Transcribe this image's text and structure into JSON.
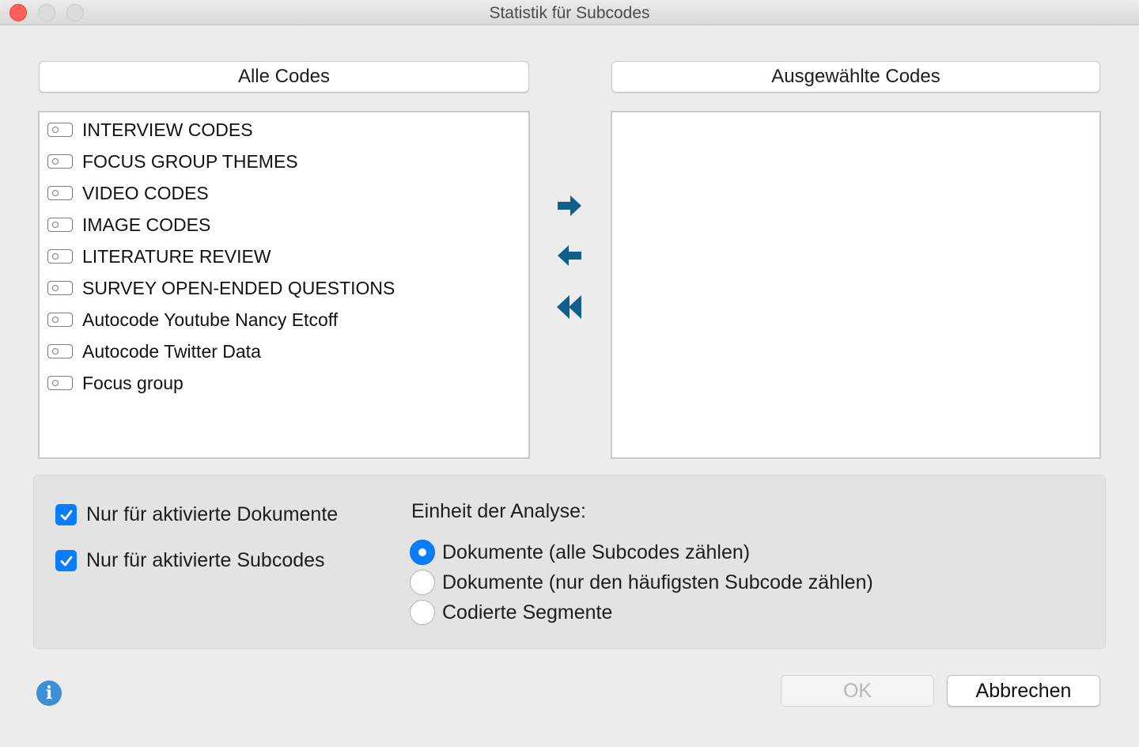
{
  "window": {
    "title": "Statistik für Subcodes"
  },
  "columns": {
    "left_header": "Alle Codes",
    "right_header": "Ausgewählte Codes"
  },
  "all_codes": [
    "INTERVIEW CODES",
    "FOCUS GROUP THEMES",
    "VIDEO CODES",
    "IMAGE CODES",
    "LITERATURE REVIEW",
    "SURVEY OPEN-ENDED QUESTIONS",
    "Autocode Youtube Nancy Etcoff",
    "Autocode Twitter Data",
    "Focus group"
  ],
  "selected_codes": [],
  "arrows": {
    "add": "arrow-right-icon",
    "remove": "arrow-left-icon",
    "remove_all": "double-arrow-left-icon",
    "color": "#0f5e8c"
  },
  "options": {
    "only_activated_documents": {
      "label": "Nur für aktivierte Dokumente",
      "checked": true
    },
    "only_activated_subcodes": {
      "label": "Nur für aktivierte Subcodes",
      "checked": true
    },
    "analysis_unit_label": "Einheit der Analyse:",
    "analysis_units": [
      {
        "label": "Dokumente (alle Subcodes zählen)",
        "selected": true
      },
      {
        "label": "Dokumente (nur den häufigsten Subcode zählen)",
        "selected": false
      },
      {
        "label": "Codierte Segmente",
        "selected": false
      }
    ]
  },
  "buttons": {
    "ok": "OK",
    "cancel": "Abbrechen"
  },
  "colors": {
    "accent": "#0a7cff",
    "info": "#3d8fd6"
  }
}
